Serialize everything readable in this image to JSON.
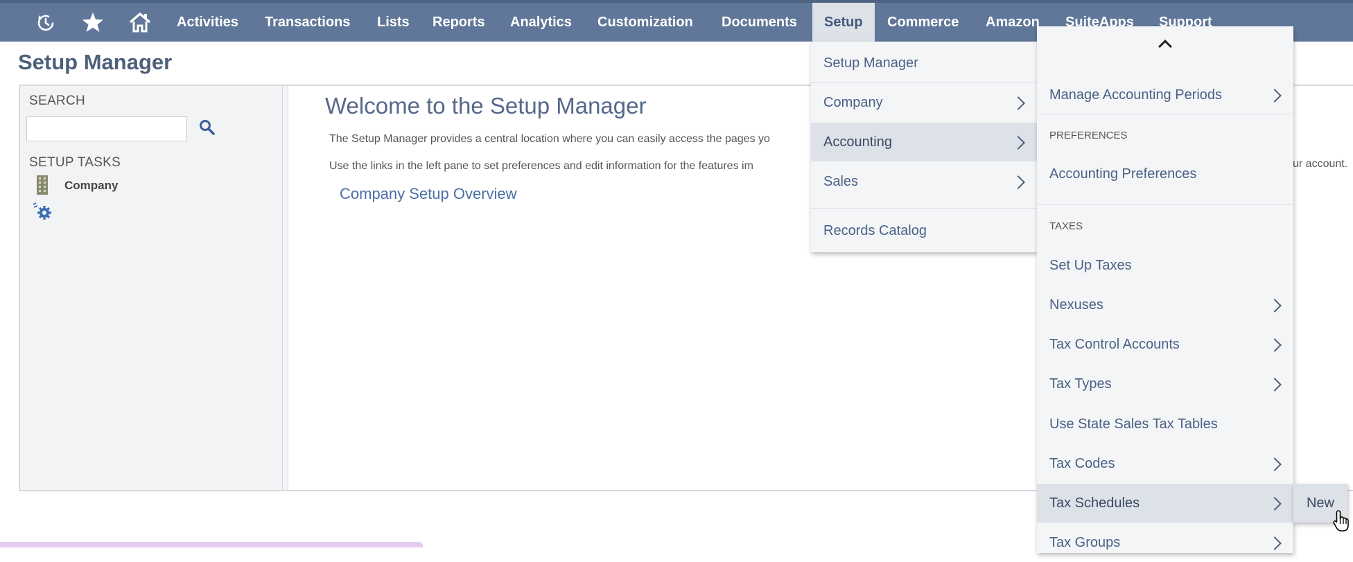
{
  "nav": {
    "icons": [
      "recent-icon",
      "star-icon",
      "home-icon"
    ],
    "items": [
      "Activities",
      "Transactions",
      "Lists",
      "Reports",
      "Analytics",
      "Customization",
      "Documents",
      "Setup",
      "Commerce",
      "Amazon",
      "SuiteApps",
      "Support"
    ],
    "active": "Setup"
  },
  "page": {
    "title": "Setup Manager"
  },
  "left_pane": {
    "search_label": "SEARCH",
    "search_value": "",
    "setup_tasks_label": "SETUP TASKS",
    "tasks": [
      {
        "label": "Company",
        "icon": "building-icon"
      }
    ],
    "extra_icon": "gear-icon"
  },
  "welcome": {
    "title": "Welcome to the Setup Manager",
    "line1": "The Setup Manager provides a central location where you can easily access the pages yo",
    "line2": "Use the links in the left pane to set preferences and edit information for the features im",
    "right_text": "ur account.",
    "link": "Company Setup Overview"
  },
  "setup_menu": {
    "items": [
      {
        "label": "Setup Manager",
        "submenu": false
      },
      {
        "label": "Company",
        "submenu": true
      },
      {
        "label": "Accounting",
        "submenu": true,
        "highlighted": true
      },
      {
        "label": "Sales",
        "submenu": true
      },
      {
        "label": "Records Catalog",
        "submenu": false
      }
    ]
  },
  "accounting_menu": {
    "scroll_indicator": "chevron-up-icon",
    "manage_periods": "Manage Accounting Periods",
    "preferences_header": "PREFERENCES",
    "accounting_preferences": "Accounting Preferences",
    "taxes_header": "TAXES",
    "items": [
      {
        "label": "Set Up Taxes",
        "submenu": false
      },
      {
        "label": "Nexuses",
        "submenu": true
      },
      {
        "label": "Tax Control Accounts",
        "submenu": true
      },
      {
        "label": "Tax Types",
        "submenu": true
      },
      {
        "label": "Use State Sales Tax Tables",
        "submenu": false
      },
      {
        "label": "Tax Codes",
        "submenu": true
      },
      {
        "label": "Tax Schedules",
        "submenu": true,
        "highlighted": true
      },
      {
        "label": "Tax Groups",
        "submenu": true
      }
    ]
  },
  "tax_schedules_menu": {
    "items": [
      "New"
    ]
  },
  "colors": {
    "nav_bg": "#607799",
    "highlight": "#dde1e8",
    "link": "#4a6fa5"
  }
}
